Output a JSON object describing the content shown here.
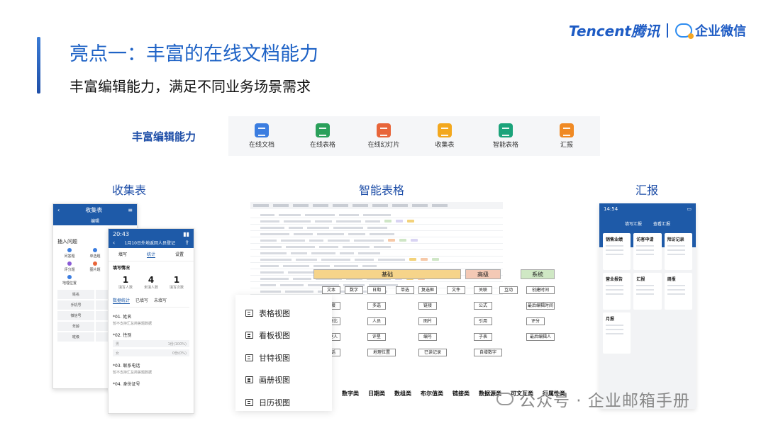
{
  "slide": {
    "title": "亮点一：丰富的在线文档能力",
    "subtitle": "丰富编辑能力，满足不同业务场景需求"
  },
  "brand": {
    "tencent": "Tencent腾讯",
    "wecom": "企业微信"
  },
  "capabilities": {
    "label": "丰富编辑能力",
    "items": [
      {
        "name": "在线文档",
        "icon": "doc-icon",
        "color": "#3b7de0"
      },
      {
        "name": "在线表格",
        "icon": "sheet-icon",
        "color": "#2aa05a"
      },
      {
        "name": "在线幻灯片",
        "icon": "slides-icon",
        "color": "#e8653a"
      },
      {
        "name": "收集表",
        "icon": "form-icon",
        "color": "#f3a81e"
      },
      {
        "name": "智能表格",
        "icon": "smartsheet-icon",
        "color": "#1ba37a"
      },
      {
        "name": "汇报",
        "icon": "report-icon",
        "color": "#f08a24"
      }
    ]
  },
  "sections": {
    "form": "收集表",
    "smart": "智能表格",
    "report": "汇报"
  },
  "form_phone_back": {
    "header": "收集表",
    "tab": "编辑",
    "panel_title": "插入问题",
    "grid": [
      {
        "label": "问答题",
        "color": "#3b7de0"
      },
      {
        "label": "单选题",
        "color": "#3b7de0"
      },
      {
        "label": "多选题",
        "color": "#3b7de0"
      },
      {
        "label": "评分题",
        "color": "#8a5bd6"
      },
      {
        "label": "图片题",
        "color": "#e8653a"
      },
      {
        "label": "投票题",
        "color": "#2aa05a"
      },
      {
        "label": "地理位置",
        "color": "#3b7de0"
      }
    ],
    "fields": [
      "姓名",
      "性别",
      "手机号",
      "邮箱",
      "微信号",
      "QQ号",
      "年龄",
      "地区",
      "班级",
      "学号"
    ]
  },
  "form_phone_front": {
    "time": "20:43",
    "header": "1月10日外地返回人员登记",
    "tabs": [
      "填写",
      "统计",
      "设置"
    ],
    "section": "填写情况",
    "stats": [
      {
        "value": "1",
        "label": "填写人数"
      },
      {
        "value": "4",
        "label": "未填人数"
      },
      {
        "value": "1",
        "label": "填写次数"
      }
    ],
    "detail_tabs": [
      "数据统计",
      "已填写",
      "未填写"
    ],
    "questions": [
      {
        "title": "*01. 姓名",
        "sub": "暂不支持汇总简答题数据"
      },
      {
        "title": "*02. 性别",
        "sub": ""
      },
      {
        "title": "*03. 联系电话",
        "sub": "暂不支持汇总简答题数据"
      },
      {
        "title": "*04. 身份证号",
        "sub": ""
      }
    ],
    "options": [
      {
        "label": "男",
        "value": "1份(100%)"
      },
      {
        "label": "女",
        "value": "0份(0%)"
      }
    ]
  },
  "smart_views": [
    {
      "label": "表格视图",
      "icon": "table-view-icon"
    },
    {
      "label": "看板视图",
      "icon": "kanban-view-icon"
    },
    {
      "label": "甘特视图",
      "icon": "gantt-view-icon"
    },
    {
      "label": "画册视图",
      "icon": "gallery-view-icon"
    },
    {
      "label": "日历视图",
      "icon": "calendar-view-icon"
    }
  ],
  "field_panel": {
    "headers": [
      {
        "label": "基础",
        "color": "#f6d48a"
      },
      {
        "label": "高级",
        "color": "#f4c9b5"
      },
      {
        "label": "系统",
        "color": "#cfe8c4"
      }
    ],
    "fields": [
      "文本",
      "数字",
      "日期",
      "单选",
      "复选框",
      "文件",
      "关联",
      "互动",
      "创建时间",
      "链接",
      "多选",
      "链接",
      "公式",
      "最后编辑时间",
      "百分比",
      "人员",
      "图片",
      "引用",
      "评分",
      "创建人",
      "评星",
      "编号",
      "子表",
      "最后编辑人",
      "电话",
      "地理位置",
      "已读记录",
      "自增数字"
    ],
    "types": [
      "数字类",
      "日期类",
      "数组类",
      "布尔值类",
      "链接类",
      "数据源类",
      "可文互类",
      "行属性类"
    ]
  },
  "report_phone": {
    "time": "14:54",
    "tabs": [
      "填写汇报",
      "查看汇报"
    ],
    "cards": [
      "销售业绩",
      "访客申请",
      "拜访记录",
      "营业报告",
      "汇报",
      "周报",
      "月报"
    ]
  },
  "watermark": "公众号 · 企业邮箱手册"
}
